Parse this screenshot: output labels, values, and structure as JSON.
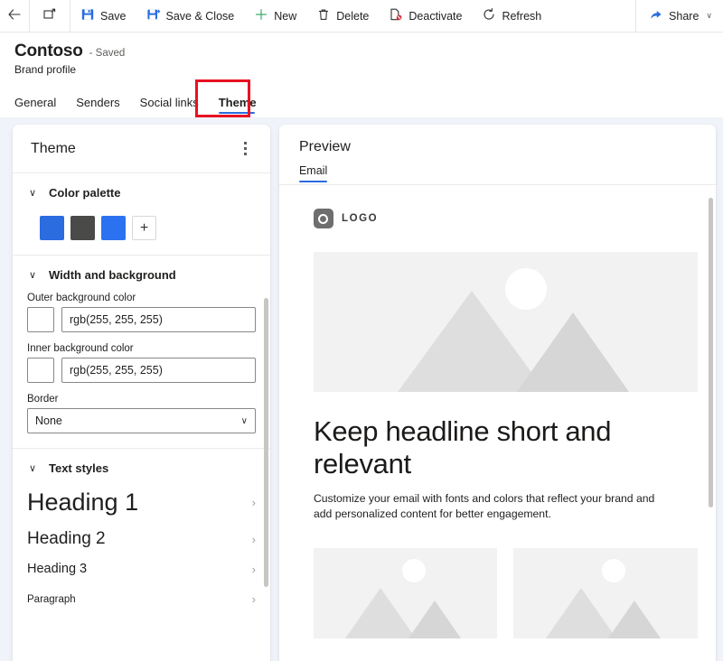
{
  "commandbar": {
    "back_icon": "back-arrow-icon",
    "popout_icon": "open-in-new-window-icon",
    "buttons": [
      {
        "label": "Save",
        "icon": "save-floppy-icon"
      },
      {
        "label": "Save & Close",
        "icon": "save-and-close-icon"
      },
      {
        "label": "New",
        "icon": "plus-icon"
      },
      {
        "label": "Delete",
        "icon": "trash-icon"
      },
      {
        "label": "Deactivate",
        "icon": "deactivate-icon"
      },
      {
        "label": "Refresh",
        "icon": "refresh-icon"
      }
    ],
    "share": {
      "label": "Share",
      "icon": "share-icon",
      "chevron": "∨"
    }
  },
  "header": {
    "title": "Contoso",
    "saved_status": "- Saved",
    "subtitle": "Brand profile",
    "tabs": [
      {
        "label": "General",
        "selected": false
      },
      {
        "label": "Senders",
        "selected": false
      },
      {
        "label": "Social links",
        "selected": false
      },
      {
        "label": "Theme",
        "selected": true
      }
    ]
  },
  "annotation": {
    "color": "#e81123",
    "target": "Theme"
  },
  "theme_panel": {
    "title": "Theme",
    "menu_icon": "kebab-menu-icon",
    "color_palette": {
      "title": "Color palette",
      "chevron": "∨",
      "swatches": [
        "#2b6ce0",
        "#4a4a48",
        "#2b72f0"
      ],
      "add_label": "+"
    },
    "width_background": {
      "title": "Width and background",
      "chevron": "∨",
      "outer_label": "Outer background color",
      "outer_value": "rgb(255, 255, 255)",
      "outer_swatch": "#ffffff",
      "inner_label": "Inner background color",
      "inner_value": "rgb(255, 255, 255)",
      "inner_swatch": "#ffffff",
      "border_label": "Border",
      "border_value": "None",
      "border_chevron": "∨"
    },
    "text_styles": {
      "title": "Text styles",
      "chevron": "∨",
      "items": [
        {
          "label": "Heading 1",
          "chevron": "›"
        },
        {
          "label": "Heading 2",
          "chevron": "›"
        },
        {
          "label": "Heading 3",
          "chevron": "›"
        },
        {
          "label": "Paragraph",
          "chevron": "›"
        }
      ]
    }
  },
  "preview_panel": {
    "title": "Preview",
    "tabs": [
      {
        "label": "Email",
        "selected": true
      }
    ],
    "email": {
      "logo_text": "LOGO",
      "logo_icon": "logo-mark-icon",
      "hero_image_alt": "image-placeholder",
      "headline": "Keep headline short and relevant",
      "body": "Customize your email with fonts and colors that reflect your brand and add personalized content for better engagement.",
      "columns": [
        {
          "image_alt": "image-placeholder"
        },
        {
          "image_alt": "image-placeholder"
        }
      ]
    }
  },
  "colors": {
    "accent": "#2b6ce0",
    "page_background": "#f0f3f9",
    "panel_background": "#ffffff",
    "annotation": "#e81123"
  }
}
